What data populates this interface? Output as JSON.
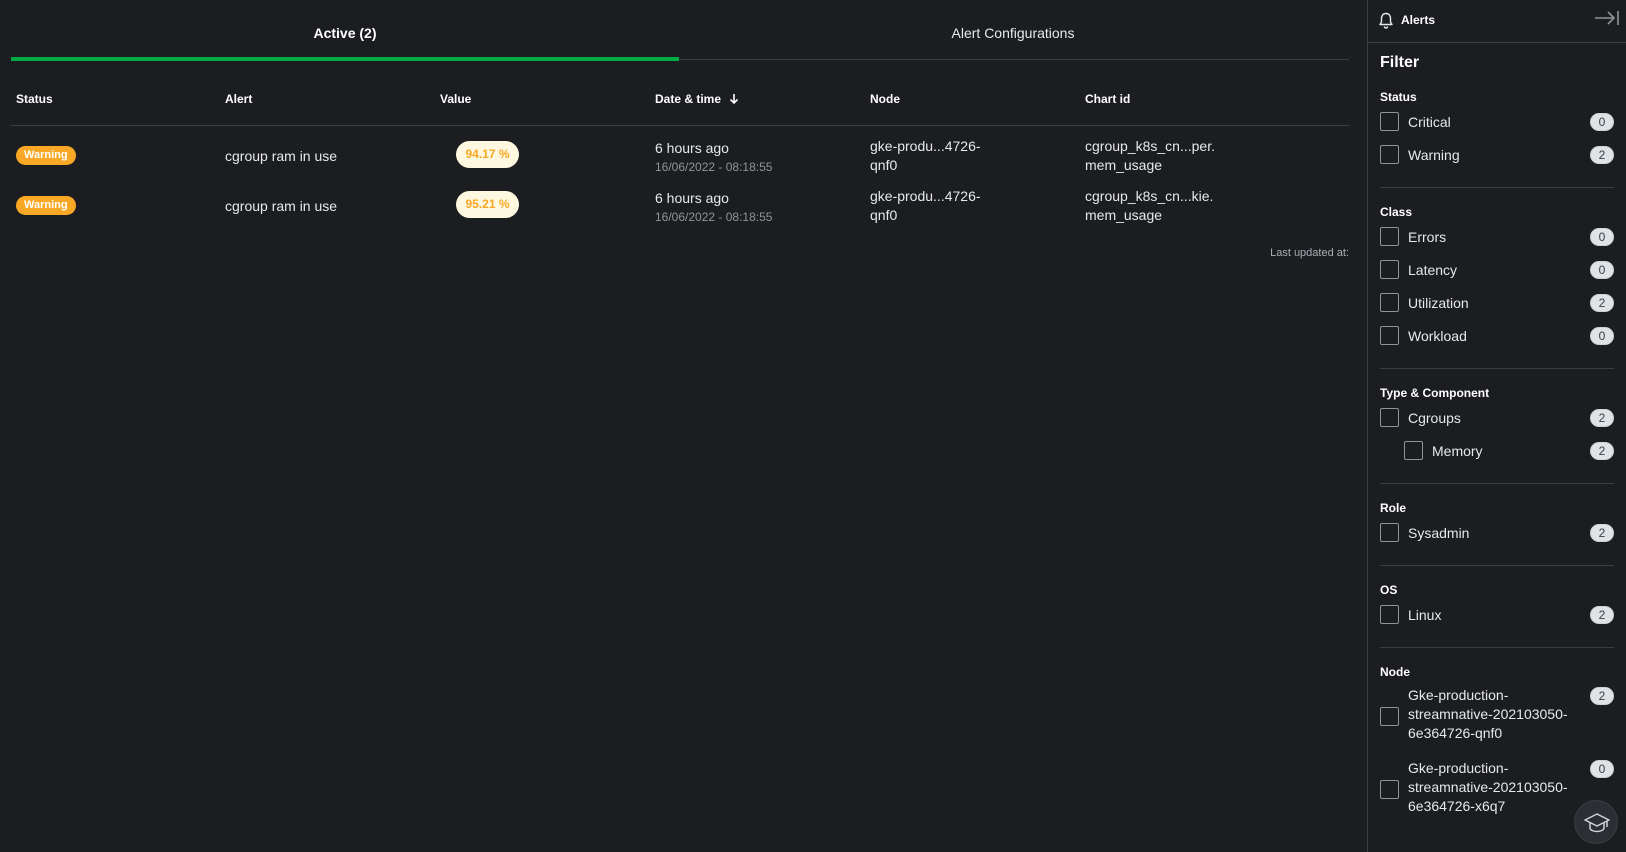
{
  "tabs": [
    {
      "label": "Active (2)"
    },
    {
      "label": "Alert Configurations"
    }
  ],
  "table": {
    "headers": [
      "Status",
      "Alert",
      "Value",
      "Date & time",
      "Node",
      "Chart id"
    ],
    "rows": [
      {
        "status": "Warning",
        "alert": "cgroup ram in use",
        "value": "94.17 %",
        "date_relative": "6 hours ago",
        "date_absolute": "16/06/2022 - 08:18:55",
        "node_line1": "gke-produ...4726-",
        "node_line2": "qnf0",
        "chart_line1": "cgroup_k8s_cn...per.",
        "chart_line2": "mem_usage"
      },
      {
        "status": "Warning",
        "alert": "cgroup ram in use",
        "value": "95.21 %",
        "date_relative": "6 hours ago",
        "date_absolute": "16/06/2022 - 08:18:55",
        "node_line1": "gke-produ...4726-",
        "node_line2": "qnf0",
        "chart_line1": "cgroup_k8s_cn...kie.",
        "chart_line2": "mem_usage"
      }
    ],
    "last_updated": "Last updated at:"
  },
  "sidebar": {
    "title": "Alerts",
    "filter_title": "Filter",
    "groups": {
      "status": {
        "label": "Status",
        "options": [
          {
            "label": "Critical",
            "count": "0"
          },
          {
            "label": "Warning",
            "count": "2"
          }
        ]
      },
      "class": {
        "label": "Class",
        "options": [
          {
            "label": "Errors",
            "count": "0"
          },
          {
            "label": "Latency",
            "count": "0"
          },
          {
            "label": "Utilization",
            "count": "2"
          },
          {
            "label": "Workload",
            "count": "0"
          }
        ]
      },
      "type_component": {
        "label": "Type & Component",
        "options": [
          {
            "label": "Cgroups",
            "count": "2"
          },
          {
            "label": "Memory",
            "count": "2"
          }
        ]
      },
      "role": {
        "label": "Role",
        "options": [
          {
            "label": "Sysadmin",
            "count": "2"
          }
        ]
      },
      "os": {
        "label": "OS",
        "options": [
          {
            "label": "Linux",
            "count": "2"
          }
        ]
      },
      "node": {
        "label": "Node",
        "options": [
          {
            "label_lines": [
              "Gke-production-",
              "streamnative-202103050-",
              "6e364726-qnf0"
            ],
            "count": "2"
          },
          {
            "label_lines": [
              "Gke-production-",
              "streamnative-202103050-",
              "6e364726-x6q7"
            ],
            "count": "0"
          }
        ]
      }
    }
  },
  "colors": {
    "background": "#1c1d21",
    "accent_green": "#00ab44",
    "warning": "#f9a825"
  },
  "icons": {
    "bell": "bell-icon",
    "collapse": "collapse-right-icon",
    "sort": "arrow-down-icon",
    "help": "graduation-cap-icon"
  }
}
